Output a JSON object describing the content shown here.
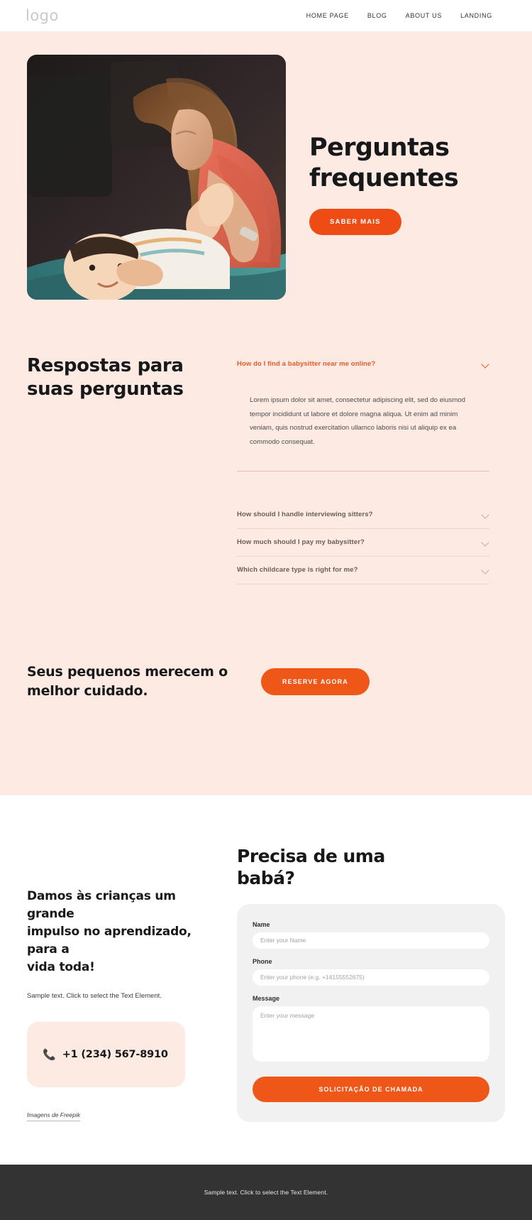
{
  "header": {
    "logo": "logo",
    "nav": [
      {
        "label": "HOME PAGE"
      },
      {
        "label": "BLOG"
      },
      {
        "label": "ABOUT US"
      },
      {
        "label": "LANDING"
      }
    ]
  },
  "hero": {
    "title_line1": "Perguntas",
    "title_line2": "frequentes",
    "cta_label": "SABER MAIS",
    "image_alt": "mother playing with baby"
  },
  "faq": {
    "heading_line1": "Respostas para",
    "heading_line2": "suas perguntas",
    "items": [
      {
        "question": "How do I find a babysitter near me online?",
        "open": true,
        "answer": "Lorem ipsum dolor sit amet, consectetur adipiscing elit, sed do eiusmod tempor incididunt ut labore et dolore magna aliqua. Ut enim ad minim veniam, quis nostrud exercitation ullamco laboris nisi ut aliquip ex ea commodo consequat."
      },
      {
        "question": "How should I handle interviewing sitters?",
        "open": false,
        "answer": ""
      },
      {
        "question": "How much should I pay my babysitter?",
        "open": false,
        "answer": ""
      },
      {
        "question": "Which childcare type is right for me?",
        "open": false,
        "answer": ""
      }
    ]
  },
  "cta_band": {
    "text_line1": "Seus pequenos merecem o",
    "text_line2": "melhor cuidado.",
    "button_label": "RESERVE AGORA"
  },
  "contact": {
    "heading_line1": "Damos às crianças um grande",
    "heading_line2": "impulso no aprendizado, para a",
    "heading_line3": "vida toda!",
    "subtext": "Sample text. Click to select the Text Element.",
    "phone_icon": "phone-icon",
    "phone": "+1 (234) 567-8910",
    "credit": "Imagens de Freepik"
  },
  "form": {
    "heading_line1": "Precisa de uma",
    "heading_line2": "babá?",
    "fields": [
      {
        "label": "Name",
        "placeholder": "Enter your Name",
        "value": ""
      },
      {
        "label": "Phone",
        "placeholder": "Enter your phone (e.g. +14155552675)",
        "value": ""
      },
      {
        "label": "Message",
        "placeholder": "Enter your message",
        "value": ""
      }
    ],
    "submit_label": "SOLICITAÇÃO DE CHAMADA"
  },
  "footer": {
    "text": "Sample text. Click to select the Text Element."
  },
  "colors": {
    "accent": "#ee5718",
    "hero_bg": "#fdeae3",
    "footer_bg": "#333333",
    "form_bg": "#f1f1f1"
  }
}
